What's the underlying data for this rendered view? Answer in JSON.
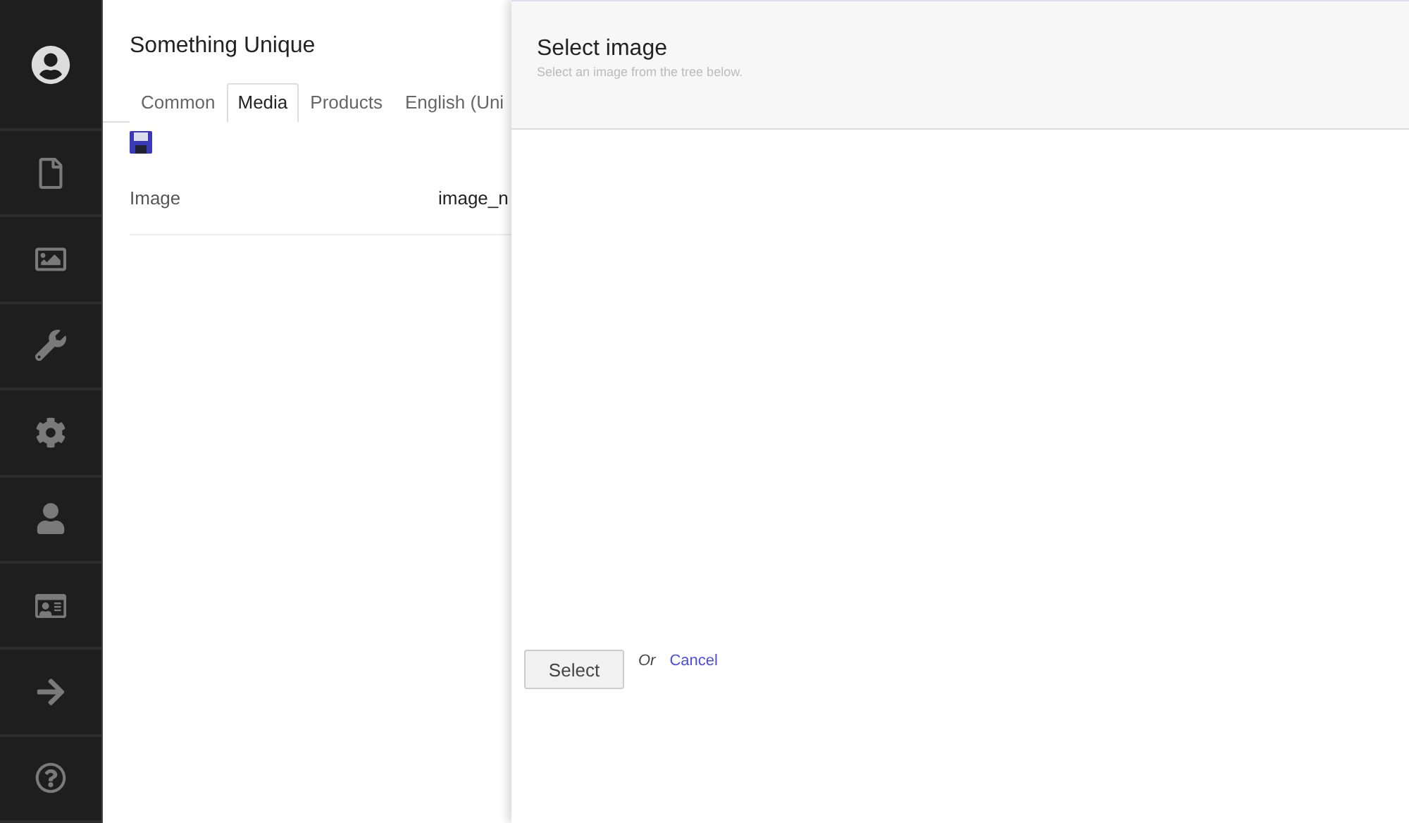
{
  "editor": {
    "title": "Something Unique",
    "tabs": [
      {
        "label": "Common",
        "selected": false
      },
      {
        "label": "Media",
        "selected": true
      },
      {
        "label": "Products",
        "selected": false
      },
      {
        "label": "English (Uni",
        "selected": false
      }
    ],
    "properties": [
      {
        "label": "Image",
        "value": "image_n"
      }
    ]
  },
  "dialog": {
    "title": "Select image",
    "subtitle": "Select an image from the tree below.",
    "select_button": "Select",
    "or_text": "Or",
    "cancel_link": "Cancel"
  }
}
